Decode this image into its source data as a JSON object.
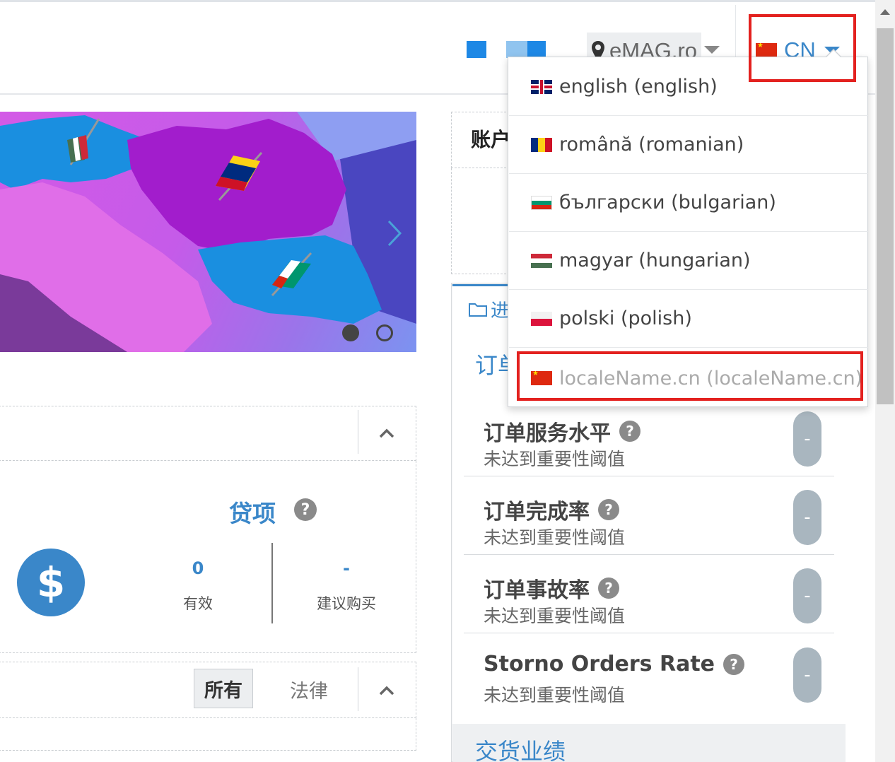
{
  "header": {
    "store": {
      "label": "eMAG.ro"
    },
    "language": {
      "code": "CN"
    }
  },
  "banner": {
    "slide_count": 2,
    "active_slide": 1
  },
  "language_menu": {
    "items": [
      {
        "label": "english (english)",
        "flag": "gb-flag-icon",
        "disabled": false
      },
      {
        "label": "română (romanian)",
        "flag": "ro-flag-icon",
        "disabled": false
      },
      {
        "label": "български (bulgarian)",
        "flag": "bg-flag-icon",
        "disabled": false
      },
      {
        "label": "magyar (hungarian)",
        "flag": "hu-flag-icon",
        "disabled": false
      },
      {
        "label": "polski (polish)",
        "flag": "pl-flag-icon",
        "disabled": false
      },
      {
        "label": "localeName.cn (localeName.cn)",
        "flag": "cn-flag-icon",
        "disabled": true
      }
    ]
  },
  "loans": {
    "title": "贷项",
    "help": "?",
    "currency_icon": "$",
    "stats": [
      {
        "value": "0",
        "label": "有效"
      },
      {
        "value": "-",
        "label": "建议购买"
      }
    ]
  },
  "filters": {
    "active": "所有",
    "other": "法律"
  },
  "account": {
    "title": "账户"
  },
  "performance": {
    "tab_label": "进",
    "orders_heading": "订单",
    "metrics": [
      {
        "title": "订单服务水平",
        "subtitle": "未达到重要性阈值",
        "value": "-"
      },
      {
        "title": "订单完成率",
        "subtitle": "未达到重要性阈值",
        "value": "-"
      },
      {
        "title": "订单事故率",
        "subtitle": "未达到重要性阈值",
        "value": "-"
      },
      {
        "title": "Storno Orders Rate",
        "subtitle": "未达到重要性阈值",
        "value": "-"
      }
    ],
    "delivery_heading": "交货业绩"
  },
  "colors": {
    "accent": "#3a87c9",
    "highlight": "#e3211f",
    "pill": "#a9b6bf"
  }
}
